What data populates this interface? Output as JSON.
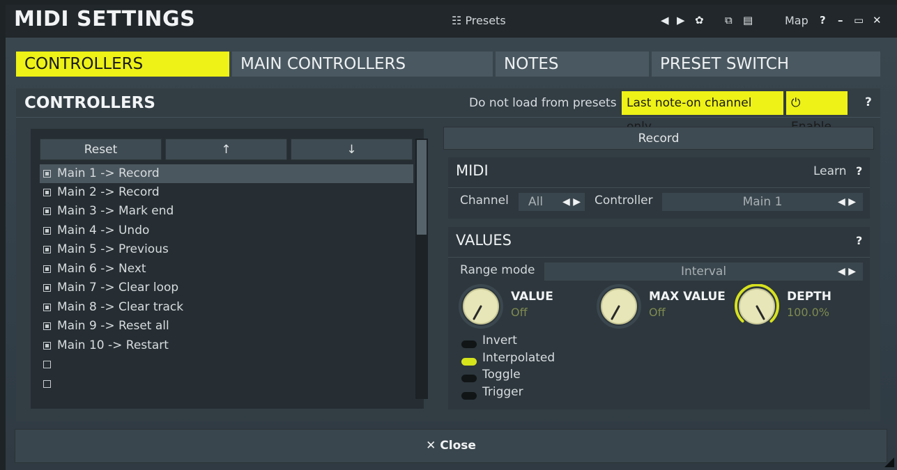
{
  "window": {
    "title": "MIDI SETTINGS",
    "presets_label": "Presets",
    "map_label": "Map",
    "icons": [
      "grid-icon",
      "prev-arrow-icon",
      "next-arrow-icon",
      "random-dice-icon",
      "copy-icon",
      "paste-icon",
      "help-icon",
      "minimize-icon",
      "maximize-icon",
      "close-icon"
    ]
  },
  "tabs": [
    {
      "label": "CONTROLLERS",
      "active": true
    },
    {
      "label": "MAIN CONTROLLERS",
      "active": false
    },
    {
      "label": "NOTES",
      "active": false
    },
    {
      "label": "PRESET SWITCH",
      "active": false
    }
  ],
  "section": {
    "title": "CONTROLLERS",
    "no_load_label": "Do not load from presets",
    "last_note_label": "Last note-on channel only",
    "enable_label": "Enable",
    "help": "?"
  },
  "list": {
    "reset_label": "Reset",
    "up_label": "↑",
    "down_label": "↓",
    "items": [
      {
        "label": "Main 1 -> Record",
        "checked": true,
        "selected": true
      },
      {
        "label": "Main 2 -> Record",
        "checked": true
      },
      {
        "label": "Main 3 -> Mark end",
        "checked": true
      },
      {
        "label": "Main 4 -> Undo",
        "checked": true
      },
      {
        "label": "Main 5 -> Previous",
        "checked": true
      },
      {
        "label": "Main 6 -> Next",
        "checked": true
      },
      {
        "label": "Main 7 -> Clear loop",
        "checked": true
      },
      {
        "label": "Main 8 -> Clear track",
        "checked": true
      },
      {
        "label": "Main 9 -> Reset all",
        "checked": true
      },
      {
        "label": "Main 10 -> Restart",
        "checked": true
      },
      {
        "label": "",
        "checked": false
      },
      {
        "label": "",
        "checked": false
      }
    ]
  },
  "detail": {
    "record_label": "Record",
    "midi": {
      "title": "MIDI",
      "learn_label": "Learn",
      "help": "?",
      "channel_label": "Channel",
      "channel_value": "All",
      "controller_label": "Controller",
      "controller_value": "Main 1"
    },
    "values": {
      "title": "VALUES",
      "help": "?",
      "range_mode_label": "Range mode",
      "range_mode_value": "Interval",
      "knobs": [
        {
          "title": "VALUE",
          "value": "Off"
        },
        {
          "title": "MAX VALUE",
          "value": "Off"
        },
        {
          "title": "DEPTH",
          "value": "100.0%"
        }
      ],
      "toggles": [
        {
          "label": "Invert",
          "on": false
        },
        {
          "label": "Interpolated",
          "on": true
        },
        {
          "label": "Toggle",
          "on": false
        },
        {
          "label": "Trigger",
          "on": false
        }
      ]
    }
  },
  "footer": {
    "close_label": "Close"
  },
  "colors": {
    "accent": "#eef216",
    "panel": "#33404a",
    "toggle_on": "#d6e41c"
  }
}
